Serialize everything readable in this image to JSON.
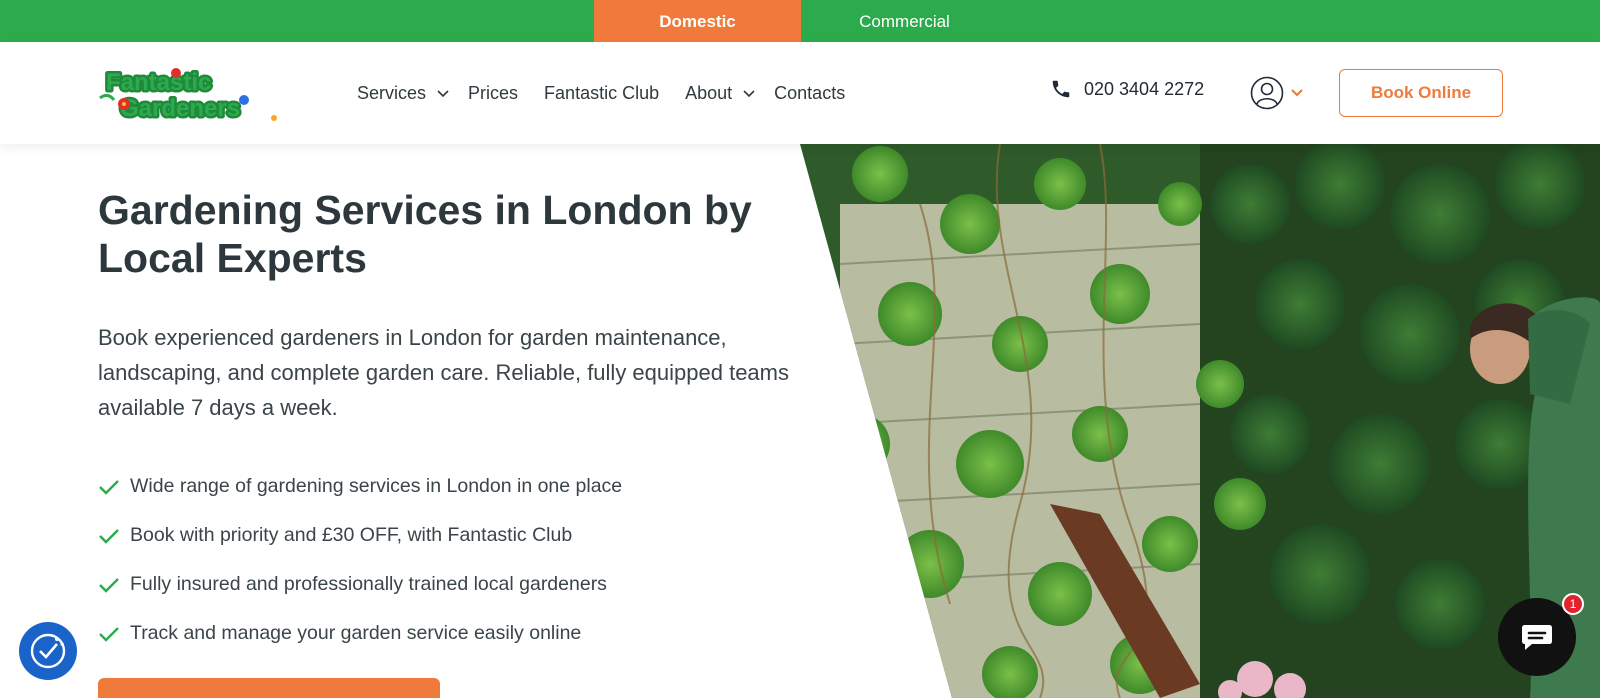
{
  "topbar": {
    "tabs": [
      {
        "label": "Domestic",
        "active": true
      },
      {
        "label": "Commercial",
        "active": false
      }
    ]
  },
  "header": {
    "logo_text": "Fantastic Gardeners",
    "nav": [
      {
        "label": "Services",
        "has_submenu": true
      },
      {
        "label": "Prices",
        "has_submenu": false
      },
      {
        "label": "Fantastic Club",
        "has_submenu": false
      },
      {
        "label": "About",
        "has_submenu": true
      },
      {
        "label": "Contacts",
        "has_submenu": false
      }
    ],
    "phone": "020 3404 2272",
    "account_icon": "user-circle-icon",
    "book_label": "Book Online"
  },
  "hero": {
    "title": "Gardening Services in London by Local Experts",
    "description": "Book experienced gardeners in London for garden maintenance, landscaping, and complete garden care. Reliable, fully equipped teams available 7 days a week.",
    "features": [
      "Wide range of gardening services in London in one place",
      "Book with priority and £30 OFF, with Fantastic Club",
      "Fully insured and professionally trained local gardeners",
      "Track and manage your garden service easily online"
    ],
    "image_icon": "garden-photo"
  },
  "widgets": {
    "accessibility_icon": "accessibility-icon",
    "chat_icon": "chat-bubble-icon",
    "chat_badge": "1"
  },
  "colors": {
    "brand_green": "#2bab4c",
    "brand_orange": "#ef7a3b",
    "text_dark": "#2d383d"
  }
}
